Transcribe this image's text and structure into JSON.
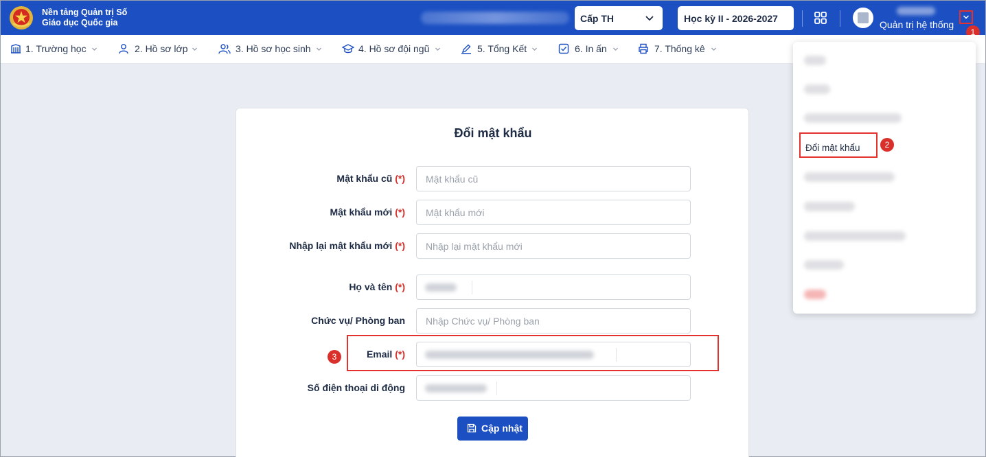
{
  "header": {
    "brand_line1": "Nền tảng Quản trị Số",
    "brand_line2": "Giáo dục Quốc gia",
    "level_select": "Cấp TH",
    "term_select": "Học kỳ II - 2026-2027",
    "user_role": "Quản trị hệ thống",
    "logo_icon": "national-emblem-icon",
    "apps_icon": "grid-icon",
    "caret_icon": "chevron-down-icon"
  },
  "menu": [
    {
      "label": "1. Trường học",
      "icon": "building-icon"
    },
    {
      "label": "2. Hồ sơ lớp",
      "icon": "user-icon"
    },
    {
      "label": "3. Hồ sơ học sinh",
      "icon": "users-icon"
    },
    {
      "label": "4. Hồ sơ đội ngũ",
      "icon": "graduation-cap-icon"
    },
    {
      "label": "5. Tổng Kết",
      "icon": "pencil-icon"
    },
    {
      "label": "6. In ấn",
      "icon": "checkbox-icon"
    },
    {
      "label": "7. Thống kê",
      "icon": "printer-icon"
    }
  ],
  "form": {
    "title": "Đổi mật khẩu",
    "required_mark": "(*)",
    "old_password_label": "Mật khẩu cũ",
    "old_password_placeholder": "Mật khẩu cũ",
    "new_password_label": "Mật khẩu mới",
    "new_password_placeholder": "Mật khẩu mới",
    "confirm_password_label": "Nhập lại mật khẩu mới",
    "confirm_password_placeholder": "Nhập lại mật khẩu mới",
    "fullname_label": "Họ và tên",
    "position_label": "Chức vụ/ Phòng ban",
    "position_placeholder": "Nhập Chức vụ/ Phòng ban",
    "email_label": "Email",
    "phone_label": "Số điện thoại di động",
    "submit_label": "Cập nhật"
  },
  "dropdown": {
    "active_item": "Đổi mật khẩu"
  },
  "annotations": {
    "step1": "1",
    "step2": "2",
    "step3": "3"
  },
  "colors": {
    "primary": "#1b4fc2",
    "highlight": "#e3322e",
    "required": "#d9302b"
  }
}
